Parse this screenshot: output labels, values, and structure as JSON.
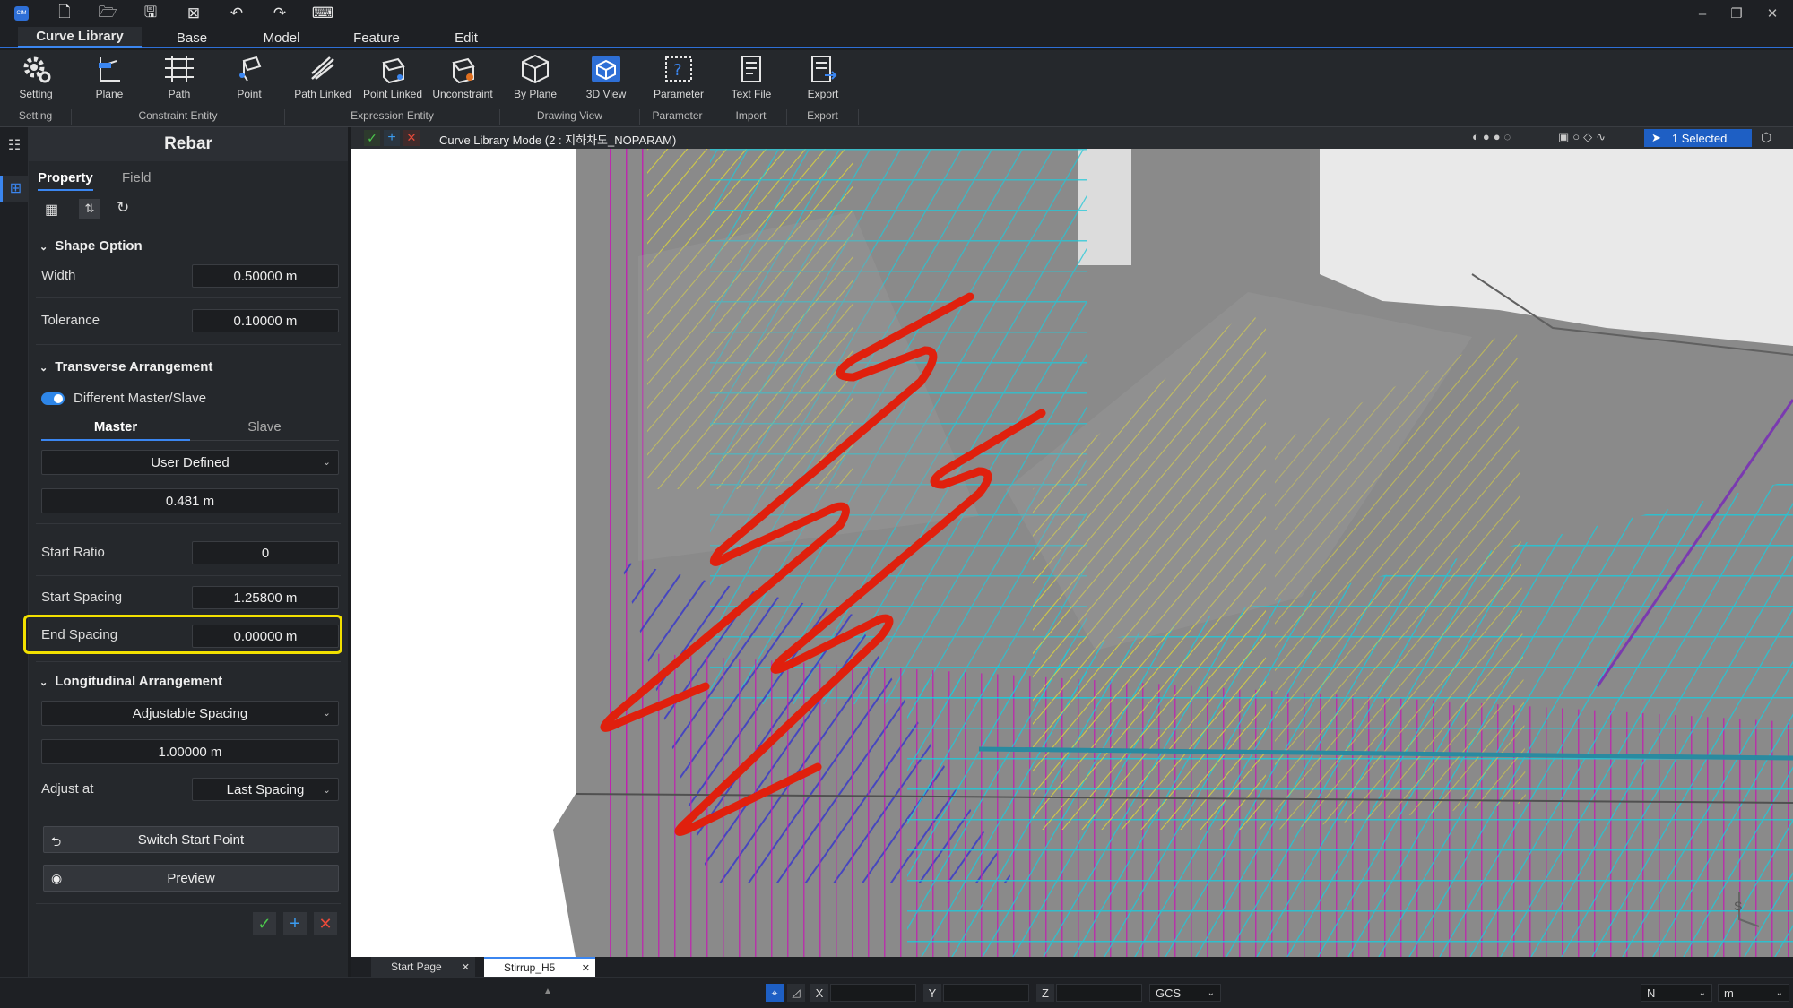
{
  "menu": {
    "tabs": [
      "Curve Library",
      "Base",
      "Model",
      "Feature",
      "Edit"
    ]
  },
  "ribbon": {
    "buttons": [
      "Setting",
      "Plane",
      "Path",
      "Point",
      "Path Linked",
      "Point Linked",
      "Unconstraint",
      "By Plane",
      "3D View",
      "Parameter",
      "Text File",
      "Export"
    ],
    "groups": [
      "Setting",
      "Constraint Entity",
      "Expression Entity",
      "Drawing View",
      "Parameter",
      "Import",
      "Export"
    ]
  },
  "panel": {
    "title": "Rebar",
    "tabs": [
      "Property",
      "Field"
    ],
    "shape_option": {
      "title": "Shape Option",
      "width_label": "Width",
      "width_value": "0.50000 m",
      "tolerance_label": "Tolerance",
      "tolerance_value": "0.10000 m"
    },
    "transverse": {
      "title": "Transverse Arrangement",
      "toggle_label": "Different Master/Slave",
      "toggle_on": true,
      "subtabs": [
        "Master",
        "Slave"
      ],
      "method": "User Defined",
      "spacing_value": "0.481 m",
      "start_ratio_label": "Start Ratio",
      "start_ratio_value": "0",
      "start_spacing_label": "Start Spacing",
      "start_spacing_value": "1.25800 m",
      "end_spacing_label": "End Spacing",
      "end_spacing_value": "0.00000 m"
    },
    "longitudinal": {
      "title": "Longitudinal Arrangement",
      "method": "Adjustable Spacing",
      "spacing_value": "1.00000 m",
      "adjust_label": "Adjust at",
      "adjust_value": "Last Spacing"
    },
    "switch_button": "Switch Start Point",
    "preview_button": "Preview"
  },
  "viewport": {
    "mode_title": "Curve Library Mode (2 : 지하차도_NOPARAM)",
    "selection": "1 Selected"
  },
  "doc_tabs": [
    "Start Page",
    "Stirrup_H5"
  ],
  "statusbar": {
    "x_label": "X",
    "y_label": "Y",
    "z_label": "Z",
    "coord_system": "GCS",
    "snap": "N",
    "unit": "m"
  },
  "colors": {
    "accent": "#2e6fd6",
    "highlight": "#f2e000",
    "rebar_selected": "#e0200d",
    "rebar_cyan": "#20c8d8",
    "rebar_magenta": "#c020b0",
    "rebar_yellow": "#d8d040"
  }
}
